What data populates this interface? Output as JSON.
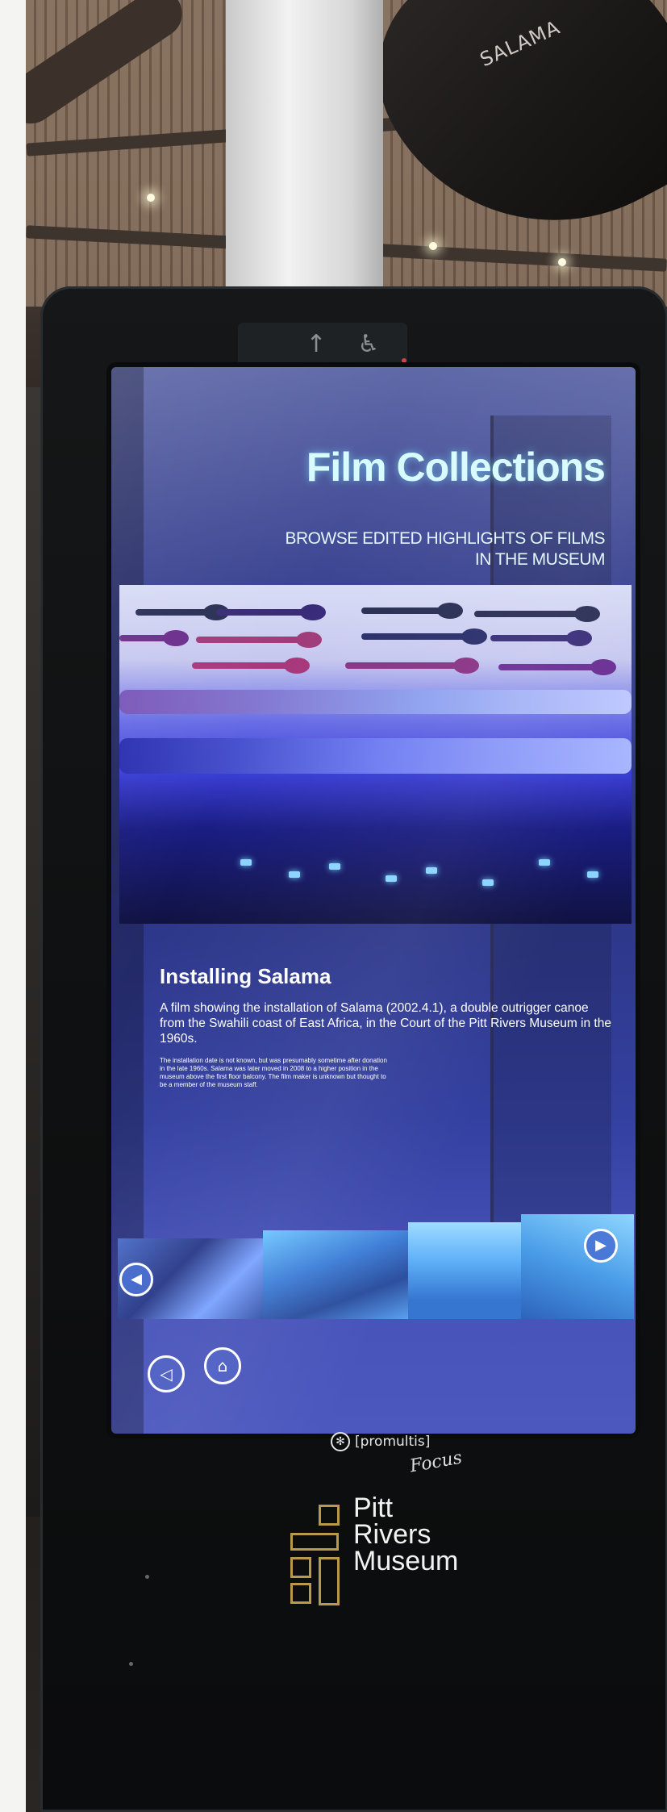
{
  "scene": {
    "canoe_label": "SALAMA"
  },
  "kiosk": {
    "sensor_icons": [
      "up-arrow-icon",
      "wheelchair-access-icon"
    ]
  },
  "screen": {
    "title": "Film Collections",
    "subtitle": "BROWSE EDITED HIGHLIGHTS OF FILMS IN THE MUSEUM",
    "film": {
      "title": "Installing Salama",
      "description": "A film showing the installation of Salama (2002.4.1), a double outrigger canoe from the Swahili coast of East Africa, in the Court of the Pitt Rivers Museum in the 1960s.",
      "note": "The installation date is not known, but was presumably sometime after donation in the late 1960s. Salama was later moved in 2008 to a higher position in the museum above the first floor balcony. The film maker is unknown but thought to be a member of the museum staff."
    },
    "carousel": {
      "prev_icon": "chevron-left-icon",
      "next_icon": "chevron-right-icon",
      "thumbnail_count": 4
    },
    "controls": {
      "back_icon": "back-icon",
      "home_icon": "home-icon"
    }
  },
  "branding": {
    "promultis": "[promultis]",
    "focus": "Focus",
    "museum_name": [
      "Pitt",
      "Rivers",
      "Museum"
    ]
  },
  "colors": {
    "title_glow": "#d8fbff",
    "logo_gold": "#b99a4a",
    "screen_blue": "#3440a0"
  }
}
